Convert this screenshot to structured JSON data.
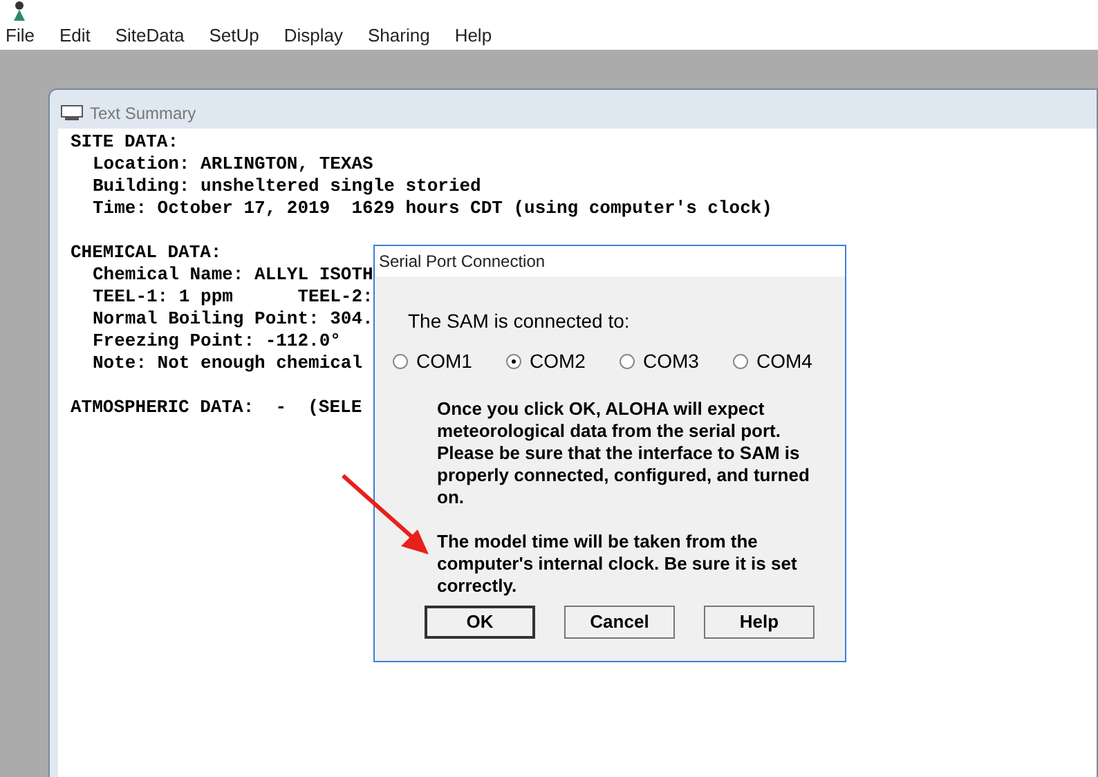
{
  "menu": [
    "File",
    "Edit",
    "SiteData",
    "SetUp",
    "Display",
    "Sharing",
    "Help"
  ],
  "text_summary": {
    "title": "Text Summary",
    "sections": [
      {
        "heading": "SITE DATA:",
        "lines": [
          "Location: ARLINGTON, TEXAS",
          "Building: unsheltered single storied",
          "Time: October 17, 2019  1629 hours CDT (using computer's clock)"
        ]
      },
      {
        "heading": "CHEMICAL DATA:",
        "lines": [
          "Chemical Name: ALLYL ISOTH",
          "TEEL-1: 1 ppm      TEEL-2:",
          "Normal Boiling Point: 304.",
          "Freezing Point: -112.0°",
          "Note: Not enough chemical"
        ]
      },
      {
        "heading": "ATMOSPHERIC DATA:  -  (SELE"
      }
    ]
  },
  "dialog": {
    "title": "Serial Port Connection",
    "prompt": "The SAM is connected to:",
    "ports": [
      {
        "label": "COM1",
        "selected": false
      },
      {
        "label": "COM2",
        "selected": true
      },
      {
        "label": "COM3",
        "selected": false
      },
      {
        "label": "COM4",
        "selected": false
      }
    ],
    "paragraphs": [
      "Once you click OK, ALOHA will expect meteorological data from the serial port. Please be sure that the interface to SAM is properly connected, configured, and turned on.",
      "The model time will be taken from the computer's internal clock.  Be sure it is set correctly."
    ],
    "buttons": [
      {
        "label": "OK",
        "default": true
      },
      {
        "label": "Cancel",
        "default": false
      },
      {
        "label": "Help",
        "default": false
      }
    ]
  }
}
